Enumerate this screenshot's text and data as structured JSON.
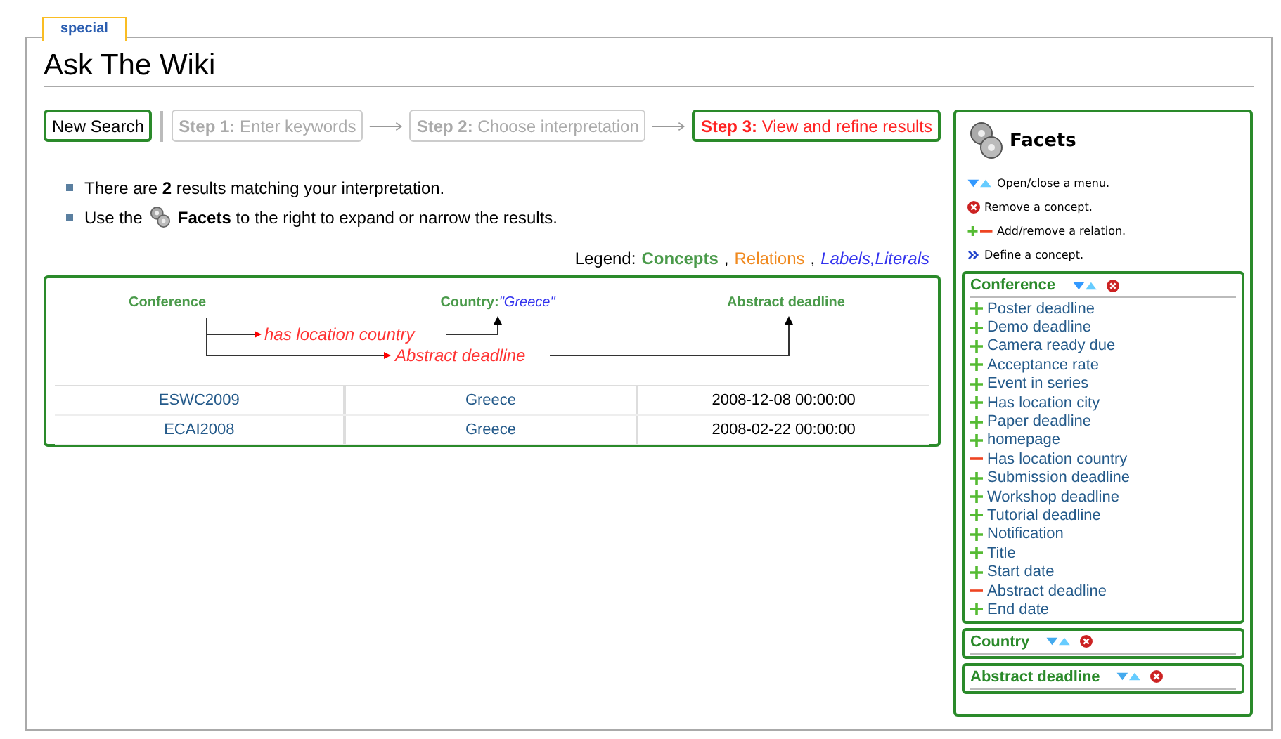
{
  "tab": {
    "label": "special",
    "selected": true
  },
  "title": "Ask The Wiki",
  "new_search": "New Search",
  "steps": [
    {
      "step": "Step 1:",
      "label": "Enter keywords",
      "selected": false
    },
    {
      "step": "Step 2:",
      "label": "Choose interpretation",
      "selected": false
    },
    {
      "step": "Step 3:",
      "label": "View and refine results",
      "selected": true
    }
  ],
  "info": [
    "There are **2** results matching your interpretation.",
    "Use the",
    "**Facets** to the right to expand or narrow the results."
  ],
  "legend": {
    "label": "Legend:",
    "concepts": "Concepts",
    "sep1": ",",
    "relations": "Relations",
    "sep2": ",",
    "literals": "Labels,Literals"
  },
  "query": {
    "concepts": [
      {
        "name": "Conference"
      },
      {
        "name": "Country:",
        "literal": "\"Greece\""
      },
      {
        "name": "Abstract deadline"
      }
    ],
    "relations": [
      "has location country",
      "Abstract deadline"
    ]
  },
  "table": {
    "rows": [
      [
        "ESWC2009",
        "Greece",
        "2008-12-08 00:00:00"
      ],
      [
        "ECAI2008",
        "Greece",
        "2008-02-22 00:00:00"
      ]
    ]
  },
  "facets": {
    "title": "Facets",
    "help": [
      {
        "kind": "toggle",
        "text": "Open/close a menu."
      },
      {
        "kind": "remove",
        "text": "Remove a concept."
      },
      {
        "kind": "addremove",
        "text": "Add/remove a relation."
      },
      {
        "kind": "define",
        "text": "Define a concept."
      }
    ],
    "groups": [
      {
        "name": "Conference",
        "expanded": true,
        "items": [
          {
            "label": "Poster deadline",
            "active": false
          },
          {
            "label": "Demo deadline",
            "active": false
          },
          {
            "label": "Camera ready due",
            "active": false
          },
          {
            "label": "Acceptance rate",
            "active": false
          },
          {
            "label": "Event in series",
            "active": false
          },
          {
            "label": "Has location city",
            "active": false
          },
          {
            "label": "Paper deadline",
            "active": false
          },
          {
            "label": "homepage",
            "active": false
          },
          {
            "label": "Has location country",
            "active": true
          },
          {
            "label": "Submission deadline",
            "active": false
          },
          {
            "label": "Workshop deadline",
            "active": false
          },
          {
            "label": "Tutorial deadline",
            "active": false
          },
          {
            "label": "Notification",
            "active": false
          },
          {
            "label": "Title",
            "active": false
          },
          {
            "label": "Start date",
            "active": false
          },
          {
            "label": "Abstract deadline",
            "active": true
          },
          {
            "label": "End date",
            "active": false
          }
        ]
      },
      {
        "name": "Country",
        "expanded": false
      },
      {
        "name": "Abstract deadline",
        "expanded": false
      }
    ]
  }
}
